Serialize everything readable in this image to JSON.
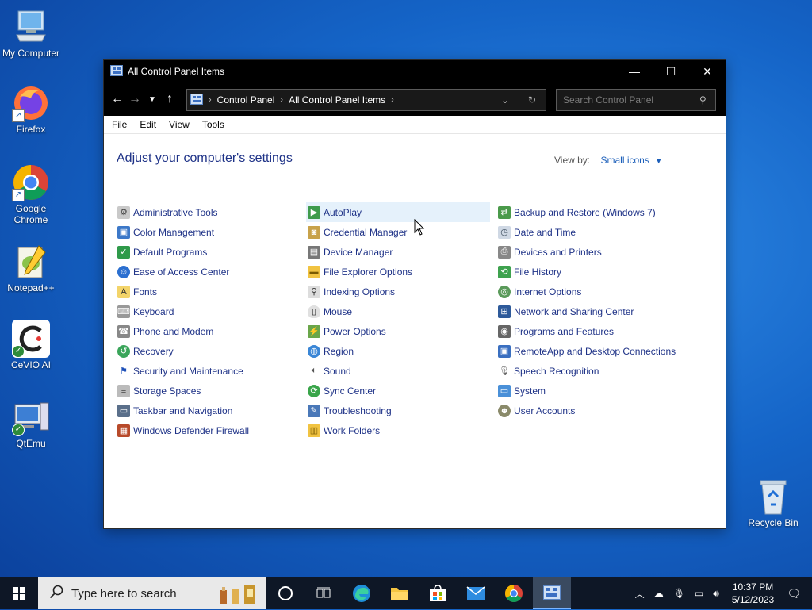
{
  "desktop": {
    "icons": [
      {
        "label": "My Computer"
      },
      {
        "label": "Firefox"
      },
      {
        "label": "Google Chrome"
      },
      {
        "label": "Notepad++"
      },
      {
        "label": "CeVIO AI"
      },
      {
        "label": "QtEmu"
      }
    ],
    "recycle_bin": "Recycle Bin"
  },
  "window": {
    "title": "All Control Panel Items",
    "breadcrumb": [
      "Control Panel",
      "All Control Panel Items"
    ],
    "search_placeholder": "Search Control Panel",
    "menu": [
      "File",
      "Edit",
      "View",
      "Tools"
    ],
    "heading": "Adjust your computer's settings",
    "view_by_label": "View by:",
    "view_by_value": "Small icons",
    "columns": [
      [
        "Administrative Tools",
        "Color Management",
        "Default Programs",
        "Ease of Access Center",
        "Fonts",
        "Keyboard",
        "Phone and Modem",
        "Recovery",
        "Security and Maintenance",
        "Storage Spaces",
        "Taskbar and Navigation",
        "Windows Defender Firewall"
      ],
      [
        "AutoPlay",
        "Credential Manager",
        "Device Manager",
        "File Explorer Options",
        "Indexing Options",
        "Mouse",
        "Power Options",
        "Region",
        "Sound",
        "Sync Center",
        "Troubleshooting",
        "Work Folders"
      ],
      [
        "Backup and Restore (Windows 7)",
        "Date and Time",
        "Devices and Printers",
        "File History",
        "Internet Options",
        "Network and Sharing Center",
        "Programs and Features",
        "RemoteApp and Desktop Connections",
        "Speech Recognition",
        "System",
        "User Accounts"
      ]
    ],
    "hovered_item": "AutoPlay"
  },
  "taskbar": {
    "search_text": "Type here to search",
    "time": "10:37 PM",
    "date": "5/12/2023"
  }
}
